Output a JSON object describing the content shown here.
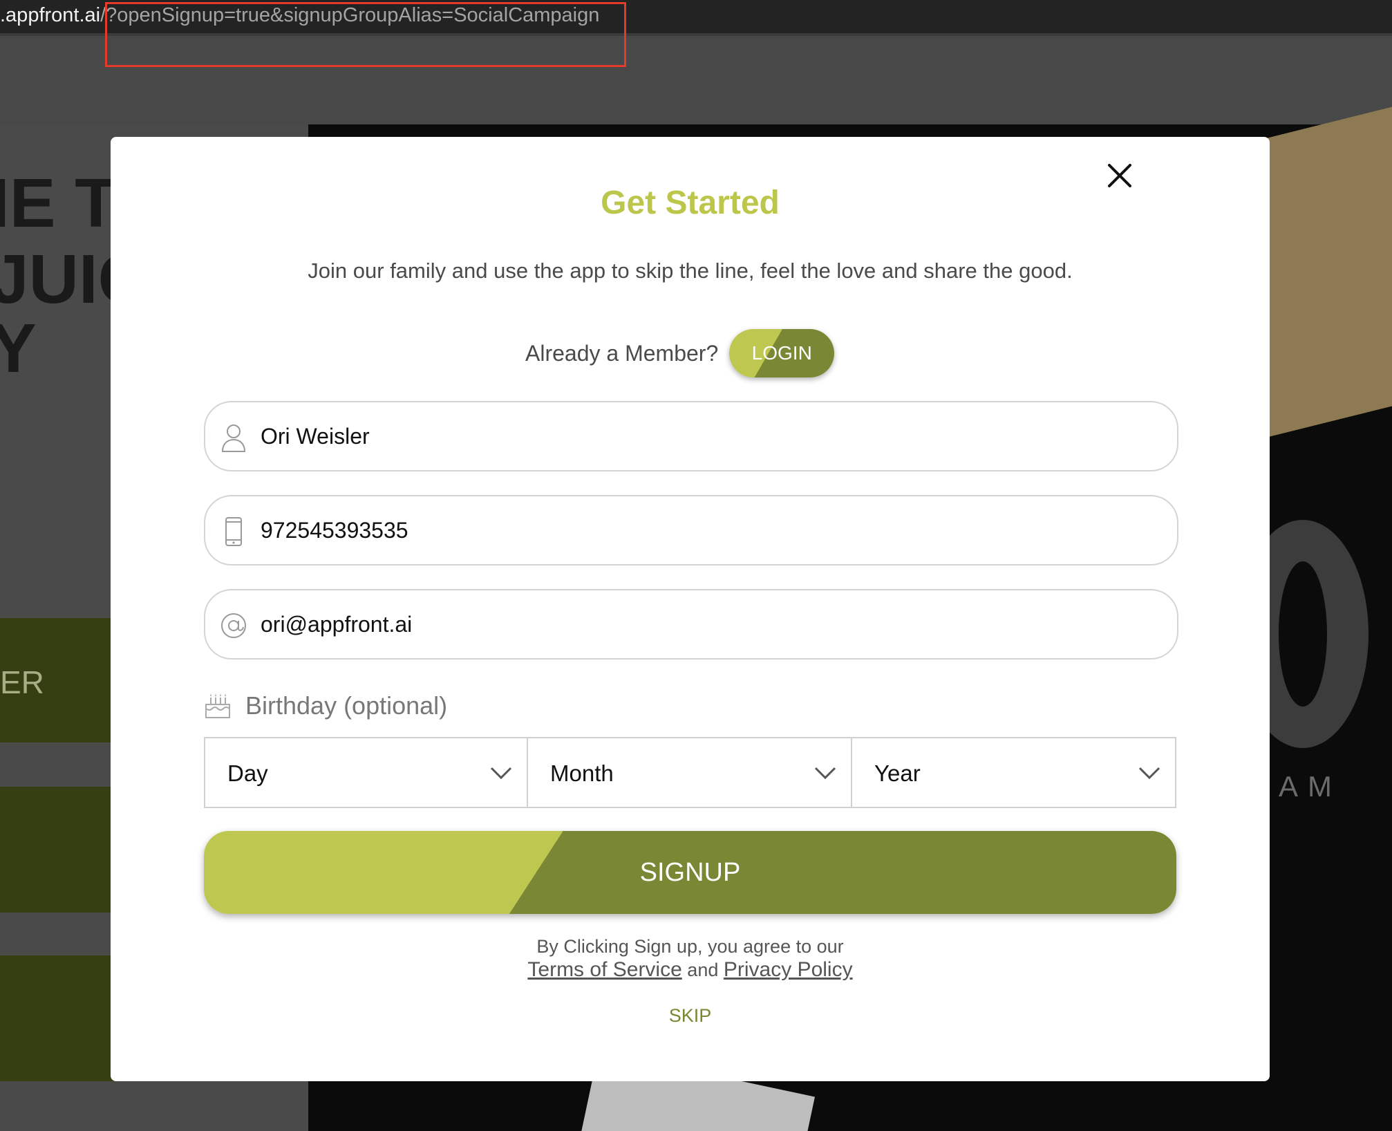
{
  "browser": {
    "url_domain": ".appfront.ai",
    "url_path": "/?openSignup=true&signupGroupAlias=SocialCampaign"
  },
  "background": {
    "headline_line1": "IE TO",
    "headline_line2": "JUIC",
    "headline_line3": "Y",
    "side_label": "ER",
    "right_text": "AM"
  },
  "modal": {
    "title": "Get Started",
    "subtitle": "Join our family and use the app to skip the line, feel the love and share the good.",
    "member_prompt": "Already a Member?",
    "login_label": "LOGIN",
    "fields": {
      "name": {
        "value": "Ori Weisler",
        "icon": "user-icon"
      },
      "phone": {
        "value": "972545393535",
        "icon": "phone-icon"
      },
      "email": {
        "value": "ori@appfront.ai",
        "icon": "at-icon"
      }
    },
    "birthday_label": "Birthday (optional)",
    "day_label": "Day",
    "month_label": "Month",
    "year_label": "Year",
    "signup_label": "SIGNUP",
    "terms_prefix": "By Clicking Sign up, you agree to our",
    "terms_link": "Terms of Service",
    "terms_and": "and",
    "privacy_link": "Privacy Policy",
    "skip_label": "SKIP"
  },
  "colors": {
    "accent_light": "#bec74f",
    "accent_dark": "#7a8734",
    "highlight": "#e5392a"
  }
}
